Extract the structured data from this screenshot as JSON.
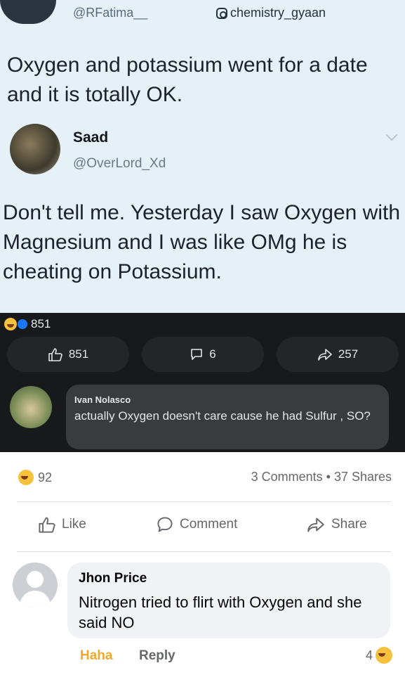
{
  "tweet": {
    "author_handle": "@RFatima__",
    "watermark": "chemistry_gyaan",
    "text": "Oxygen and potassium went for a date and it is totally OK."
  },
  "reply_tweet": {
    "name": "Saad",
    "handle": "@OverLord_Xd",
    "text": "Don't tell me. Yesterday I saw Oxygen with Magnesium and I was like OMg he is cheating on Potassium."
  },
  "dark_post": {
    "reaction_count": "851",
    "like_count": "851",
    "comment_count": "6",
    "share_count": "257",
    "comment": {
      "name": "Ivan Nolasco",
      "text": "actually Oxygen doesn't care cause he had Sulfur , SO?"
    }
  },
  "post_stats": {
    "reaction_count": "92",
    "comments_shares": "3 Comments • 37 Shares"
  },
  "actions": {
    "like": "Like",
    "comment": "Comment",
    "share": "Share"
  },
  "comment": {
    "name": "Jhon Price",
    "text": "Nitrogen tried to flirt with Oxygen and she said NO",
    "haha_label": "Haha",
    "reply_label": "Reply",
    "reaction_count": "4"
  },
  "colors": {
    "tweet_bg": "#e6f0f7",
    "dark_bg": "#18191a",
    "haha": "#f0a830",
    "secondary_text": "#65676b"
  }
}
